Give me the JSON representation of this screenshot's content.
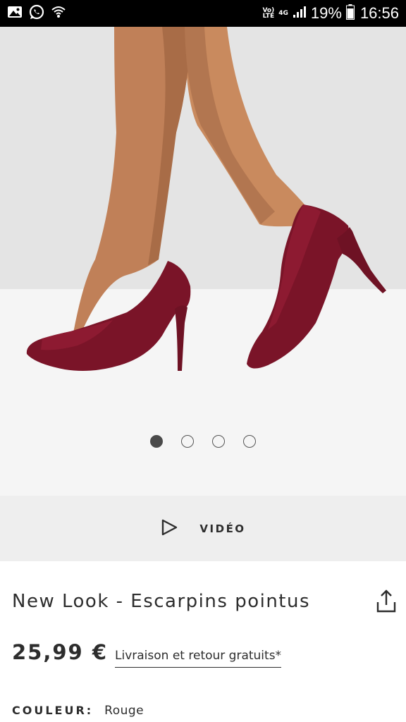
{
  "status_bar": {
    "network_label_top": "Vo)",
    "network_label_bottom": "LTE",
    "data_label": "4G",
    "battery_percent": "19%",
    "time": "16:56"
  },
  "gallery": {
    "image_alt": "Burgundy suede pointed high-heel pumps",
    "slide_count": 4,
    "active_slide": 1
  },
  "video": {
    "label": "VIDÉO"
  },
  "product": {
    "title": "New Look - Escarpins pointus",
    "price": "25,99 €",
    "shipping": "Livraison et retour gratuits*",
    "color_label": "COULEUR:",
    "color_value": "Rouge"
  },
  "colors": {
    "status_bar_bg": "#000000",
    "shoe": "#7a1428",
    "video_bar_bg": "#eeeeee",
    "text": "#2d2d2d"
  }
}
